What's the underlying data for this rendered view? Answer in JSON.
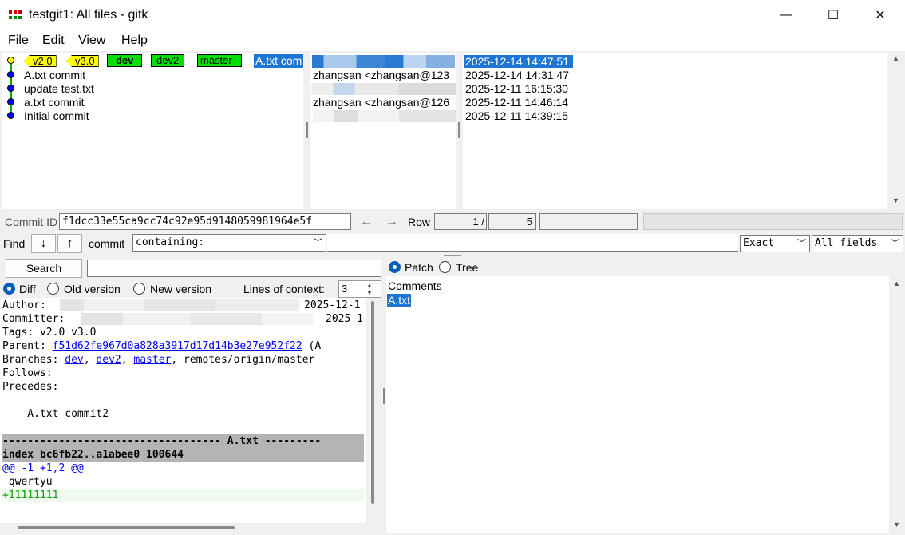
{
  "window": {
    "title": "testgit1: All files - gitk",
    "minimize": "—",
    "maximize": "☐",
    "close": "✕"
  },
  "menu": [
    "File",
    "Edit",
    "View",
    "Help"
  ],
  "commits": {
    "tags": [
      "v2.0",
      "v3.0"
    ],
    "branches": [
      "dev",
      "dev2",
      "master"
    ],
    "first_row_headline": "A.txt com",
    "rows": [
      {
        "subject": "A.txt commit",
        "author": "zhangsan <zhangsan@123",
        "date": "2025-12-14 14:31:47"
      },
      {
        "subject": "update test.txt",
        "author": "",
        "date": "2025-12-11 16:15:30"
      },
      {
        "subject": "a.txt commit",
        "author": "zhangsan <zhangsan@126",
        "date": "2025-12-11 14:46:14"
      },
      {
        "subject": "Initial commit",
        "author": "",
        "date": "2025-12-11 14:39:15"
      }
    ],
    "selected_date": "2025-12-14 14:47:51"
  },
  "idbar": {
    "label": "Commit ID",
    "sha": "f1dcc33e55ca9cc74c92e95d9148059981964e5f",
    "back": "←",
    "forward": "→",
    "row_label": "Row",
    "row_current": "1 /",
    "row_total": "5"
  },
  "find": {
    "label": "Find",
    "down": "↓",
    "up": "↑",
    "type_label": "commit",
    "mode": "containing:",
    "match": "Exact",
    "fields": "All fields"
  },
  "search": {
    "button": "Search",
    "diff": "Diff",
    "old": "Old version",
    "new": "New version",
    "context_label": "Lines of context:",
    "context_value": "3"
  },
  "details": {
    "author": "Author:",
    "author_date": "2025-12-1",
    "committer": "Committer:",
    "committer_date": "2025-1",
    "tags": "Tags: v2.0 v3.0",
    "parent_label": "Parent:",
    "parent_sha": "f51d62fe967d0a828a3917d17d14b3e27e952f22",
    "parent_tail": " (A",
    "branches_label": "Branches:",
    "branches": [
      "dev",
      "dev2",
      "master"
    ],
    "branches_tail": ", remotes/origin/master",
    "follows": "Follows:",
    "precedes": "Precedes:",
    "message": "    A.txt commit2",
    "file_header": "----------------------------------- A.txt ---------",
    "index_line": "index bc6fb22..a1abee0 100644",
    "hunk": "@@ -1 +1,2 @@",
    "context_line": " qwertyu",
    "added_line": "+11111111"
  },
  "files": {
    "patch": "Patch",
    "tree": "Tree",
    "items": [
      "Comments",
      "A.txt"
    ]
  },
  "colors": {
    "selection": "#1e76d3",
    "tag": "#ffff00",
    "branch": "#00e000",
    "link": "#0000ff",
    "hunk": "#0000ff",
    "added": "#00a000",
    "diff_header_bg": "#b4b4b4"
  }
}
